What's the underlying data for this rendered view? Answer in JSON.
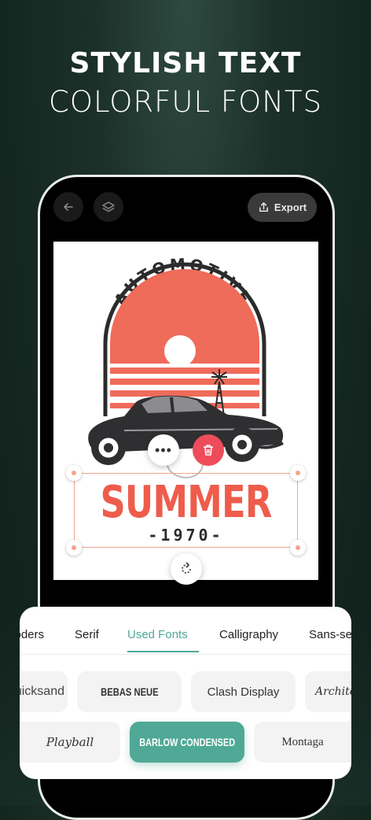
{
  "headline": {
    "line1": "STYLISH TEXT",
    "line2": "COLORFUL FONTS"
  },
  "toolbar": {
    "export_label": "Export"
  },
  "canvas": {
    "badge_top_text": "AUTOMOTIVE",
    "headline_text": "SUMMER",
    "year_text": "-1970-",
    "colors": {
      "accent": "#ee5c4c",
      "dark": "#2b2b2b",
      "selection": "#f3a48c"
    }
  },
  "font_panel": {
    "tabs": [
      {
        "label": "Moders",
        "active": false
      },
      {
        "label": "Serif",
        "active": false
      },
      {
        "label": "Used Fonts",
        "active": true
      },
      {
        "label": "Calligraphy",
        "active": false
      },
      {
        "label": "Sans-serif",
        "active": false
      }
    ],
    "row1": [
      "Quicksand",
      "BEBAS NEUE",
      "Clash Display",
      "Architects"
    ],
    "row2": [
      "Playball",
      "BARLOW CONDENSED",
      "Montaga"
    ],
    "selected_font": "BARLOW CONDENSED",
    "accent_color": "#4fa996"
  }
}
